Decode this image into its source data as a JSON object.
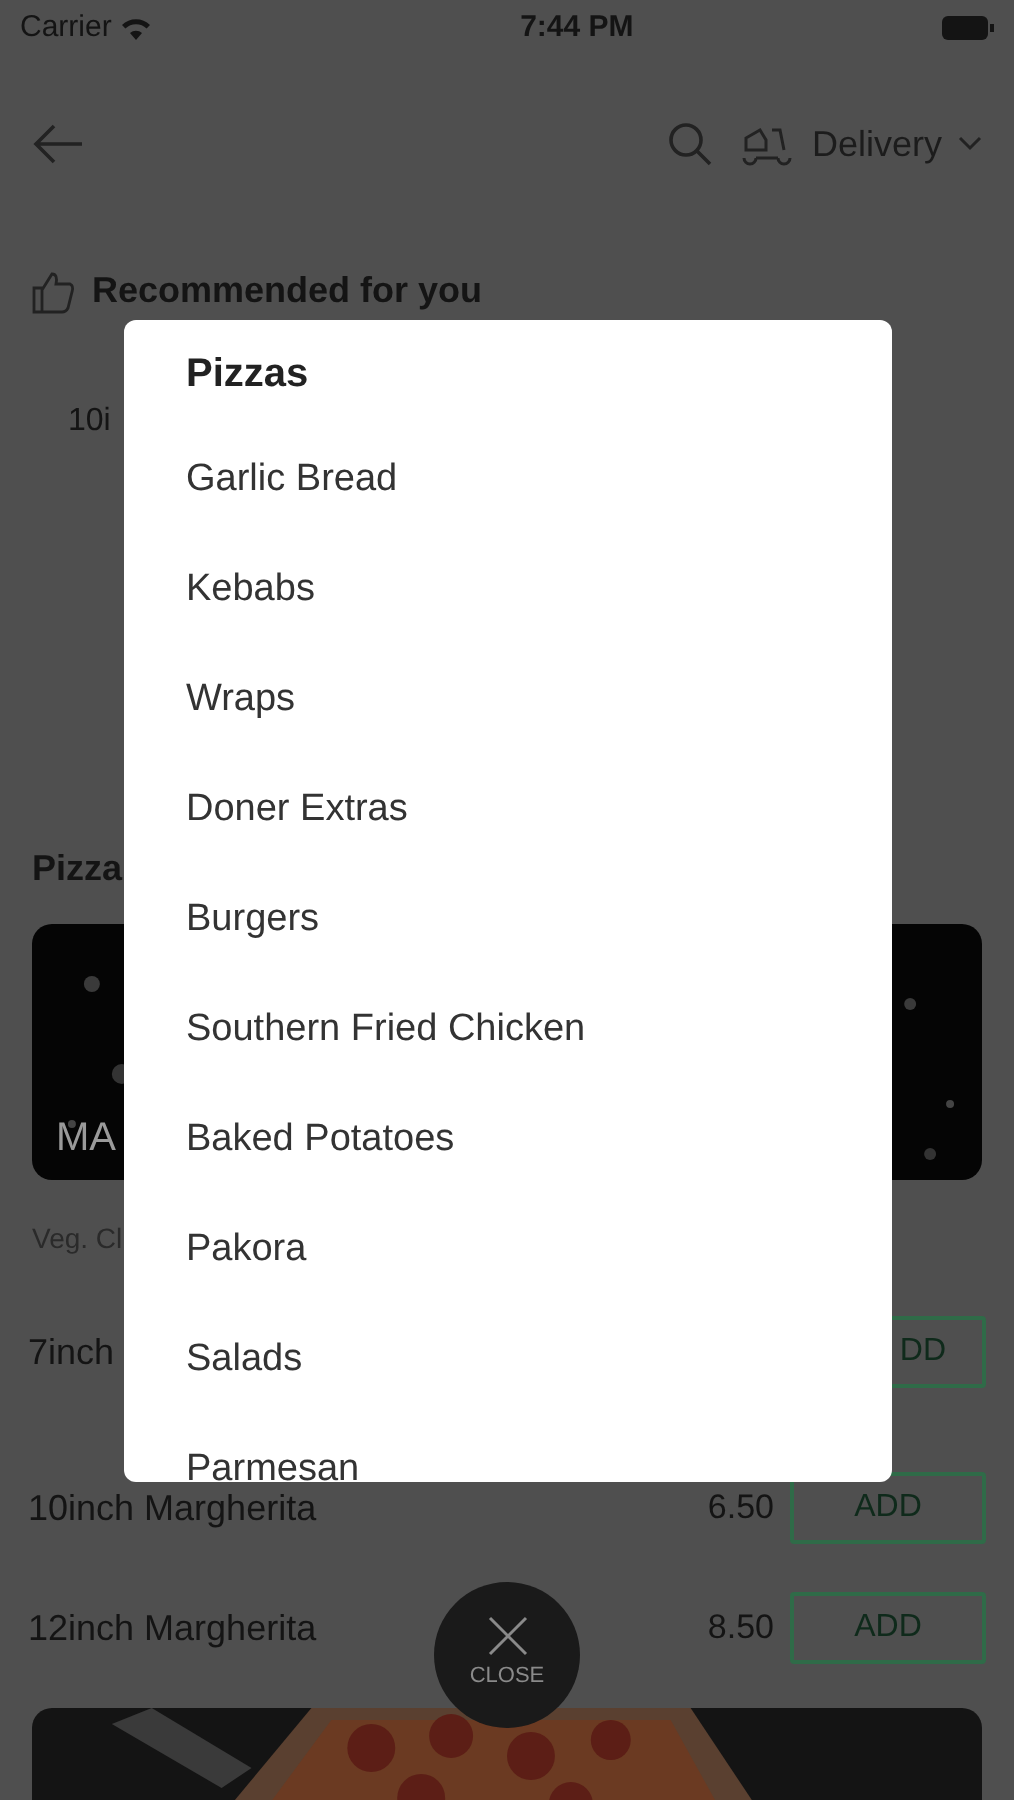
{
  "status_bar": {
    "carrier": "Carrier",
    "time": "7:44 PM"
  },
  "header": {
    "delivery_label": "Delivery"
  },
  "recommended": {
    "title": "Recommended for you",
    "item": "10i"
  },
  "section": {
    "title": "Pizza",
    "banner_text": "MA",
    "description": "Veg. Cl"
  },
  "items": [
    {
      "name": "7inch",
      "button": "DD"
    },
    {
      "name": "10inch Margherita",
      "price": "6.50",
      "button": "ADD"
    },
    {
      "name": "12inch Margherita",
      "price": "8.50",
      "button": "ADD"
    }
  ],
  "modal": {
    "title": "Pizzas",
    "categories": [
      "Garlic Bread",
      "Kebabs",
      "Wraps",
      "Doner Extras",
      "Burgers",
      "Southern Fried Chicken",
      "Baked Potatoes",
      "Pakora",
      "Salads",
      "Parmesan"
    ]
  },
  "close_button": {
    "label": "CLOSE"
  }
}
